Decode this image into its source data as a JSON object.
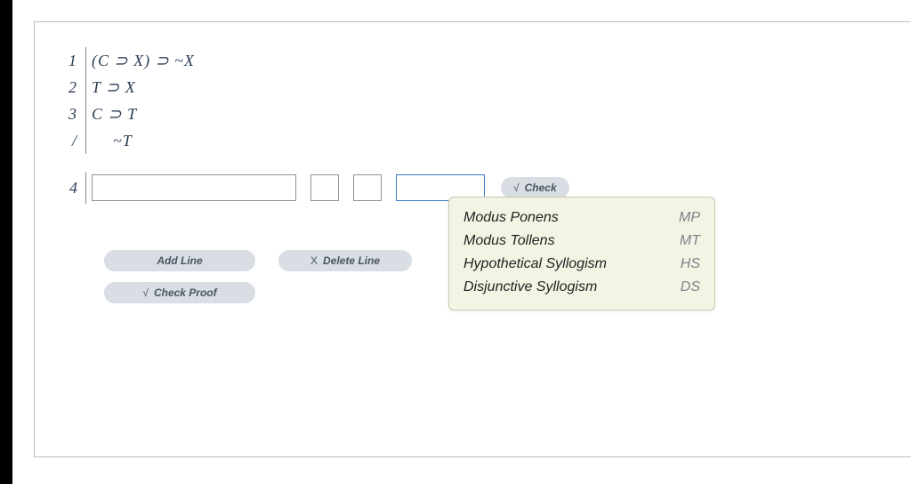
{
  "premises": [
    {
      "num": "1",
      "formula": "(C ⊃ X) ⊃ ~X"
    },
    {
      "num": "2",
      "formula": "T ⊃ X"
    },
    {
      "num": "3",
      "formula": "C ⊃ T"
    }
  ],
  "conclusion": {
    "marker": "/",
    "formula": "~T"
  },
  "workline": {
    "num": "4",
    "formula_value": "",
    "ref1_value": "",
    "ref2_value": "",
    "rule_value": ""
  },
  "buttons": {
    "check": "Check",
    "check_glyph": "√",
    "add_line": "Add Line",
    "delete_line": "Delete Line",
    "delete_glyph": "X",
    "check_proof": "Check Proof",
    "check_proof_glyph": "√"
  },
  "rules_menu": [
    {
      "name": "Modus Ponens",
      "abbr": "MP"
    },
    {
      "name": "Modus Tollens",
      "abbr": "MT"
    },
    {
      "name": "Hypothetical Syllogism",
      "abbr": "HS"
    },
    {
      "name": "Disjunctive Syllogism",
      "abbr": "DS"
    }
  ]
}
